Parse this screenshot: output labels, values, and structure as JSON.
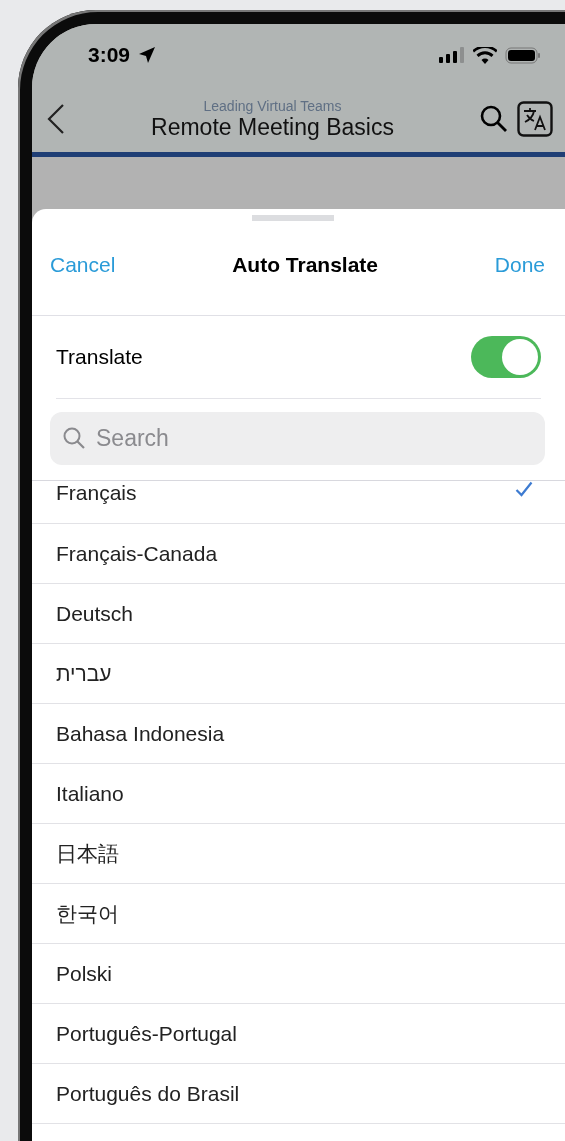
{
  "status_bar": {
    "time": "3:09"
  },
  "nav": {
    "subtitle": "Leading Virtual Teams",
    "title": "Remote Meeting Basics"
  },
  "sheet": {
    "cancel": "Cancel",
    "title": "Auto Translate",
    "done": "Done",
    "translate": {
      "label": "Translate",
      "on": true
    },
    "search": {
      "placeholder": "Search"
    },
    "languages": [
      {
        "name": "Français",
        "selected": true
      },
      {
        "name": "Français-Canada",
        "selected": false
      },
      {
        "name": "Deutsch",
        "selected": false
      },
      {
        "name": "עברית",
        "selected": false
      },
      {
        "name": "Bahasa Indonesia",
        "selected": false
      },
      {
        "name": "Italiano",
        "selected": false
      },
      {
        "name": "日本語",
        "selected": false
      },
      {
        "name": "한국어",
        "selected": false
      },
      {
        "name": "Polski",
        "selected": false
      },
      {
        "name": "Português-Portugal",
        "selected": false
      },
      {
        "name": "Português do Brasil",
        "selected": false
      }
    ]
  }
}
